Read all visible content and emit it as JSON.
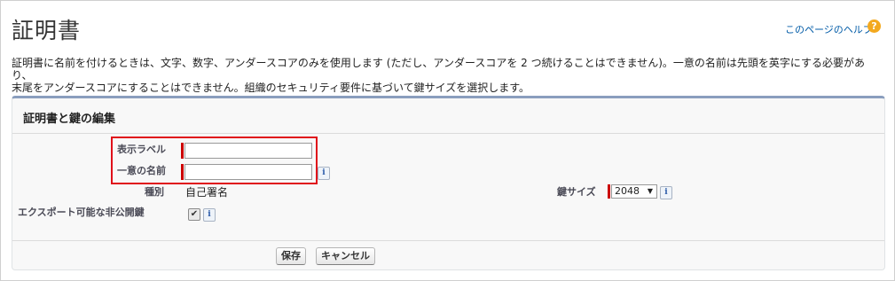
{
  "page": {
    "title": "証明書",
    "help_link": "このページのヘルプ",
    "help_icon": "?",
    "description_line1": "証明書に名前を付けるときは、文字、数字、アンダースコアのみを使用します (ただし、アンダースコアを 2 つ続けることはできません)。一意の名前は先頭を英字にする必要があり、",
    "description_line2": "末尾をアンダースコアにすることはできません。組織のセキュリティ要件に基づいて鍵サイズを選択します。"
  },
  "form": {
    "section_title": "証明書と鍵の編集",
    "label_field": {
      "label": "表示ラベル",
      "value": ""
    },
    "unique_name_field": {
      "label": "一意の名前",
      "value": ""
    },
    "type_field": {
      "label": "種別",
      "value": "自己署名"
    },
    "key_size_field": {
      "label": "鍵サイズ",
      "selected": "2048"
    },
    "exportable_field": {
      "label": "エクスポート可能な非公開鍵",
      "checked": true
    },
    "info_icon": "i"
  },
  "buttons": {
    "save": "保存",
    "cancel": "キャンセル"
  },
  "colors": {
    "required_marker": "#cc0000",
    "panel_border_top": "#8a9ebe",
    "help_icon": "#f3a91f",
    "link": "#015ba7",
    "highlight": "#e0101a"
  }
}
